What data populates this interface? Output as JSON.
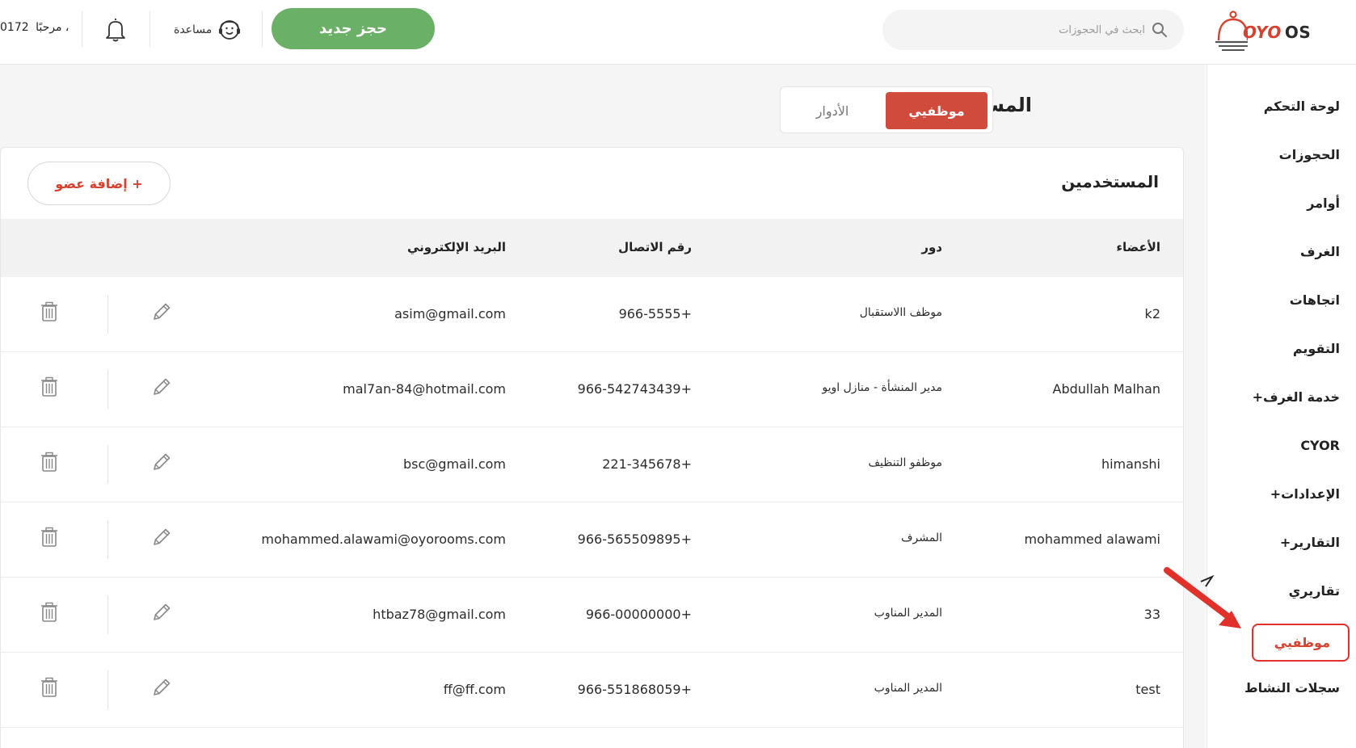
{
  "topbar": {
    "logo": {
      "oyo": "OYO",
      "os": "OS"
    },
    "search_placeholder": "ابحث في الحجوزات",
    "new_booking_label": "حجز جديد",
    "help_label": "مساعدة",
    "greeting": "مرحبًا ،",
    "user_id": "0172"
  },
  "sidebar": {
    "items": [
      {
        "label": "لوحة التحكم",
        "active": false
      },
      {
        "label": "الحجوزات",
        "active": false
      },
      {
        "label": "أوامر",
        "active": false
      },
      {
        "label": "الغرف",
        "active": false
      },
      {
        "label": "اتجاهات",
        "active": false
      },
      {
        "label": "التقويم",
        "active": false
      },
      {
        "label": "خدمة الغرف+",
        "active": false
      },
      {
        "label": "CYOR",
        "active": false
      },
      {
        "label": "الإعدادات+",
        "active": false
      },
      {
        "label": "التقارير+",
        "active": false
      },
      {
        "label": "تقاريري",
        "active": false
      },
      {
        "label": "موظفيي",
        "active": true
      },
      {
        "label": "سجلات النشاط",
        "active": false
      }
    ]
  },
  "page": {
    "title": "المستخدمين والأدوار",
    "tabs": {
      "staff": "موظفيي",
      "roles": "الأدوار"
    },
    "panel_title": "المستخدمين",
    "add_member_label": "+ إضافة عضو"
  },
  "table": {
    "headers": {
      "members": "الأعضاء",
      "role": "دور",
      "phone": "رقم الاتصال",
      "email": "البريد الإلكتروني"
    },
    "rows": [
      {
        "name": "k2",
        "role": "موظف االاستقبال",
        "phone": "966-5555+",
        "email": "asim@gmail.com"
      },
      {
        "name": "Abdullah Malhan",
        "role": "مدير المنشأة - منازل اويو",
        "phone": "966-542743439+",
        "email": "mal7an-84@hotmail.com"
      },
      {
        "name": "himanshi",
        "role": "موظفو التنظيف",
        "phone": "221-345678+",
        "email": "bsc@gmail.com"
      },
      {
        "name": "mohammed alawami",
        "role": "المشرف",
        "phone": "966-565509895+",
        "email": "mohammed.alawami@oyorooms.com"
      },
      {
        "name": "33",
        "role": "المدير المناوب",
        "phone": "966-00000000+",
        "email": "htbaz78@gmail.com"
      },
      {
        "name": "test",
        "role": "المدير المناوب",
        "phone": "966-551868059+",
        "email": "ff@ff.com"
      }
    ]
  },
  "colors": {
    "brand_red": "#d6422f",
    "green": "#6ab066",
    "active_tab": "#d14b3d"
  }
}
